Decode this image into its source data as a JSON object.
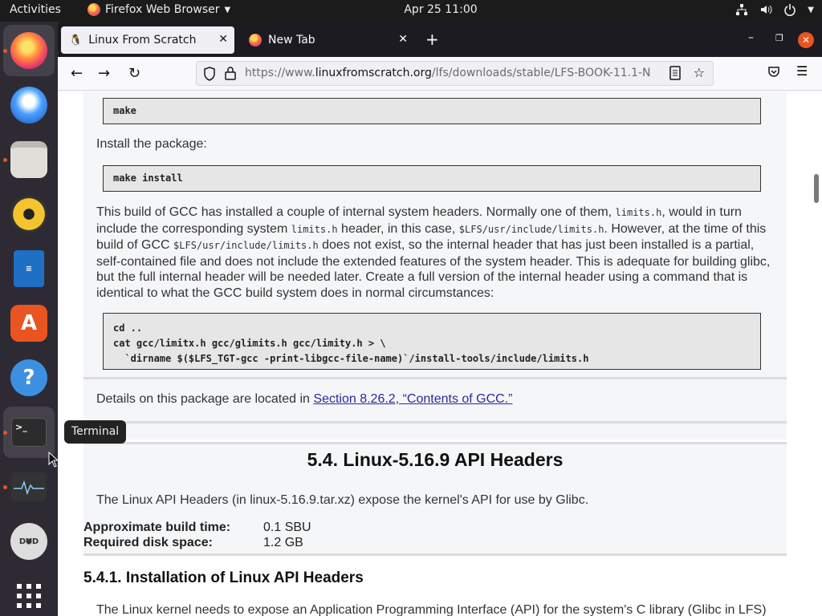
{
  "topbar": {
    "activities": "Activities",
    "app_name": "Firefox Web Browser",
    "clock": "Apr 25  11:00"
  },
  "dock": {
    "tooltip": "Terminal",
    "items": [
      "firefox-icon",
      "thunderbird-icon",
      "files-icon",
      "rhythmbox-icon",
      "writer-icon",
      "software-icon",
      "help-icon",
      "terminal-icon",
      "system-monitor-icon",
      "dvd-icon",
      "show-apps-icon"
    ]
  },
  "browser": {
    "tabs": [
      {
        "title": "Linux From Scratch",
        "active": true
      },
      {
        "title": "New Tab",
        "active": false
      }
    ],
    "url": {
      "scheme": "https://www.",
      "host": "linuxfromscratch.org",
      "path": "/lfs/downloads/stable/LFS-BOOK-11.1-N"
    }
  },
  "page": {
    "code1": "make",
    "install_label": "Install the package:",
    "code2": "make install",
    "para1_a": "This build of GCC has installed a couple of internal system headers. Normally one of them, ",
    "para1_tt1": "limits.h",
    "para1_b": ", would in turn include the corresponding system ",
    "para1_tt2": "limits.h",
    "para1_c": " header, in this case, ",
    "para1_tt3": "$LFS/usr/include/limits.h",
    "para1_d": ". However, at the time of this build of GCC ",
    "para1_tt4": "$LFS/usr/include/limits.h",
    "para1_e": " does not exist, so the internal header that has just been installed is a partial, self-contained file and does not include the extended features of the system header. This is adequate for building glibc, but the full internal header will be needed later. Create a full version of the internal header using a command that is identical to what the GCC build system does in normal circumstances:",
    "code3_l1": "cd ..",
    "code3_l2": "cat gcc/limitx.h gcc/glimits.h gcc/limity.h > \\",
    "code3_l3": "  `dirname $($LFS_TGT-gcc -print-libgcc-file-name)`/install-tools/include/limits.h",
    "details_prefix": "Details on this package are located in ",
    "details_link": "Section 8.26.2, “Contents of GCC.”",
    "section_title": "5.4. Linux-5.16.9 API Headers",
    "section_intro": "The Linux API Headers (in linux-5.16.9.tar.xz) expose the kernel's API for use by Glibc.",
    "build_time_label": "Approximate build time:",
    "build_time_value": "0.1 SBU",
    "disk_label": "Required disk space:",
    "disk_value": "1.2 GB",
    "subsection_title": "5.4.1. Installation of Linux API Headers",
    "subsection_intro": "The Linux kernel needs to expose an Application Programming Interface (API) for the system's C library (Glibc in LFS)"
  }
}
